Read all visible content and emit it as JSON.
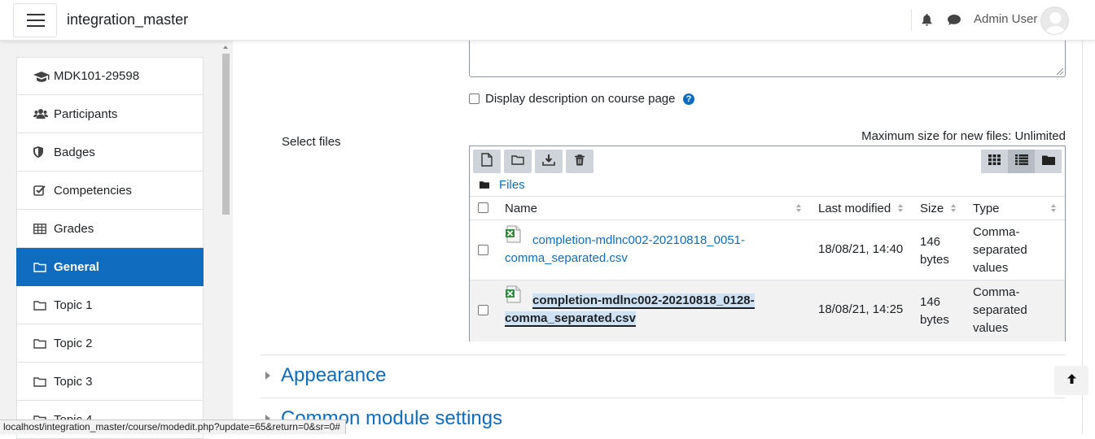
{
  "header": {
    "site_name": "integration_master",
    "user_name": "Admin User"
  },
  "drawer": {
    "items": [
      {
        "label": "MDK101-29598",
        "icon": "graduation-cap-icon"
      },
      {
        "label": "Participants",
        "icon": "users-icon"
      },
      {
        "label": "Badges",
        "icon": "shield-icon"
      },
      {
        "label": "Competencies",
        "icon": "check-square-icon"
      },
      {
        "label": "Grades",
        "icon": "table-icon"
      },
      {
        "label": "General",
        "icon": "folder-icon",
        "active": true
      },
      {
        "label": "Topic 1",
        "icon": "folder-icon"
      },
      {
        "label": "Topic 2",
        "icon": "folder-icon"
      },
      {
        "label": "Topic 3",
        "icon": "folder-icon"
      },
      {
        "label": "Topic 4",
        "icon": "folder-icon"
      }
    ]
  },
  "form": {
    "display_description_label": "Display description on course page",
    "help_icon": "?",
    "select_files_label": "Select files",
    "max_size_text": "Maximum size for new files: Unlimited"
  },
  "filepicker": {
    "path_label": "Files",
    "columns": {
      "name": "Name",
      "modified": "Last modified",
      "size": "Size",
      "type": "Type"
    },
    "files": [
      {
        "name_line1": "completion-mdlnc002-20210818_0051-",
        "name_line2": "comma_separated.csv",
        "modified": "18/08/21, 14:40",
        "size_line1": "146",
        "size_line2": "bytes",
        "type_line1": "Comma-",
        "type_line2": "separated",
        "type_line3": "values"
      },
      {
        "name_line1": "completion-mdlnc002-20210818_0128-",
        "name_line2": "comma_separated.csv",
        "modified": "18/08/21, 14:25",
        "size_line1": "146",
        "size_line2": "bytes",
        "type_line1": "Comma-",
        "type_line2": "separated",
        "type_line3": "values"
      }
    ]
  },
  "sections": {
    "appearance": "Appearance",
    "common_module": "Common module settings"
  },
  "status_bar": {
    "url": "localhost/integration_master/course/modedit.php?update=65&return=0&sr=0#"
  },
  "colors": {
    "primary": "#0f6cbf",
    "active_nav_bg": "#0f6cbf"
  }
}
